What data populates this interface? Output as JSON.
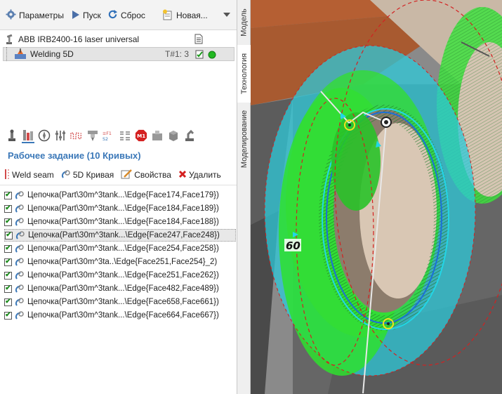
{
  "toolbar": {
    "params_label": "Параметры",
    "run_label": "Пуск",
    "reset_label": "Сброс",
    "new_label": "Новая..."
  },
  "tree": {
    "robot_label": "ABB IRB2400-16 laser universal",
    "operation_label": "Welding 5D",
    "tool_label": "T#1: 3"
  },
  "side_tabs": [
    "Модель",
    "Технология",
    "Моделирование"
  ],
  "task": {
    "title": "Рабочее задание  (10 Кривых)"
  },
  "actions": {
    "weld_seam": "Weld seam",
    "curve_5d": "5D Кривая",
    "properties": "Свойства",
    "delete": "Удалить"
  },
  "curves": [
    "Цепочка(Part\\30m^3tank...\\Edge{Face174,Face179})",
    "Цепочка(Part\\30m^3tank...\\Edge{Face184,Face189})",
    "Цепочка(Part\\30m^3tank...\\Edge{Face184,Face188})",
    "Цепочка(Part\\30m^3tank...\\Edge{Face247,Face248})",
    "Цепочка(Part\\30m^3tank...\\Edge{Face254,Face258})",
    "Цепочка(Part\\30m^3ta..\\Edge{Face251,Face254}_2)",
    "Цепочка(Part\\30m^3tank...\\Edge{Face251,Face262})",
    "Цепочка(Part\\30m^3tank...\\Edge{Face482,Face489})",
    "Цепочка(Part\\30m^3tank...\\Edge{Face658,Face661})",
    "Цепочка(Part\\30m^3tank...\\Edge{Face664,Face667})"
  ],
  "viewport": {
    "angle_label": "60"
  },
  "colors": {
    "accent_blue": "#3b78b8",
    "pipe_green": "#33dd33",
    "cylinder_cyan": "#2ec8d8",
    "part_brown": "#b8653a"
  }
}
